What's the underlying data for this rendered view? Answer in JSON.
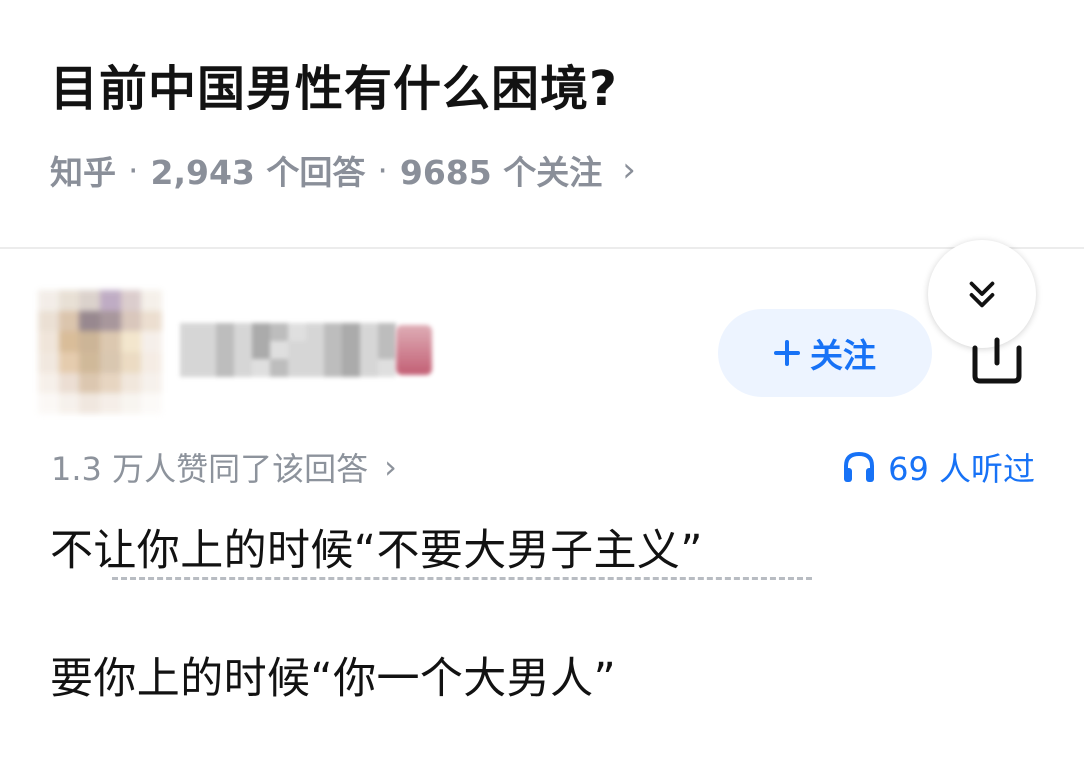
{
  "question": {
    "title": "目前中国男性有什么困境?",
    "source": "知乎",
    "separator": "·",
    "answers": "2,943 个回答",
    "followers": "9685 个关注",
    "chevron": "›"
  },
  "author": {
    "avatar": "blurred-avatar",
    "name": "blurred-author-name",
    "badge": "blurred-badge"
  },
  "actions": {
    "follow_label": "关注",
    "follow_icon": "plus-icon",
    "share_icon": "share-icon",
    "expand_icon": "double-chevron-down-icon",
    "accent": "#1772f6",
    "follow_bg": "#edf4ff"
  },
  "answer": {
    "votes": "1.3 万人赞同了该回答",
    "votes_chevron": "›",
    "listen_icon": "headphones-icon",
    "listen_text": "69 人听过",
    "lines": [
      "不让你上的时候“不要大男子主义”",
      "要你上的时候“你一个大男人”"
    ]
  }
}
